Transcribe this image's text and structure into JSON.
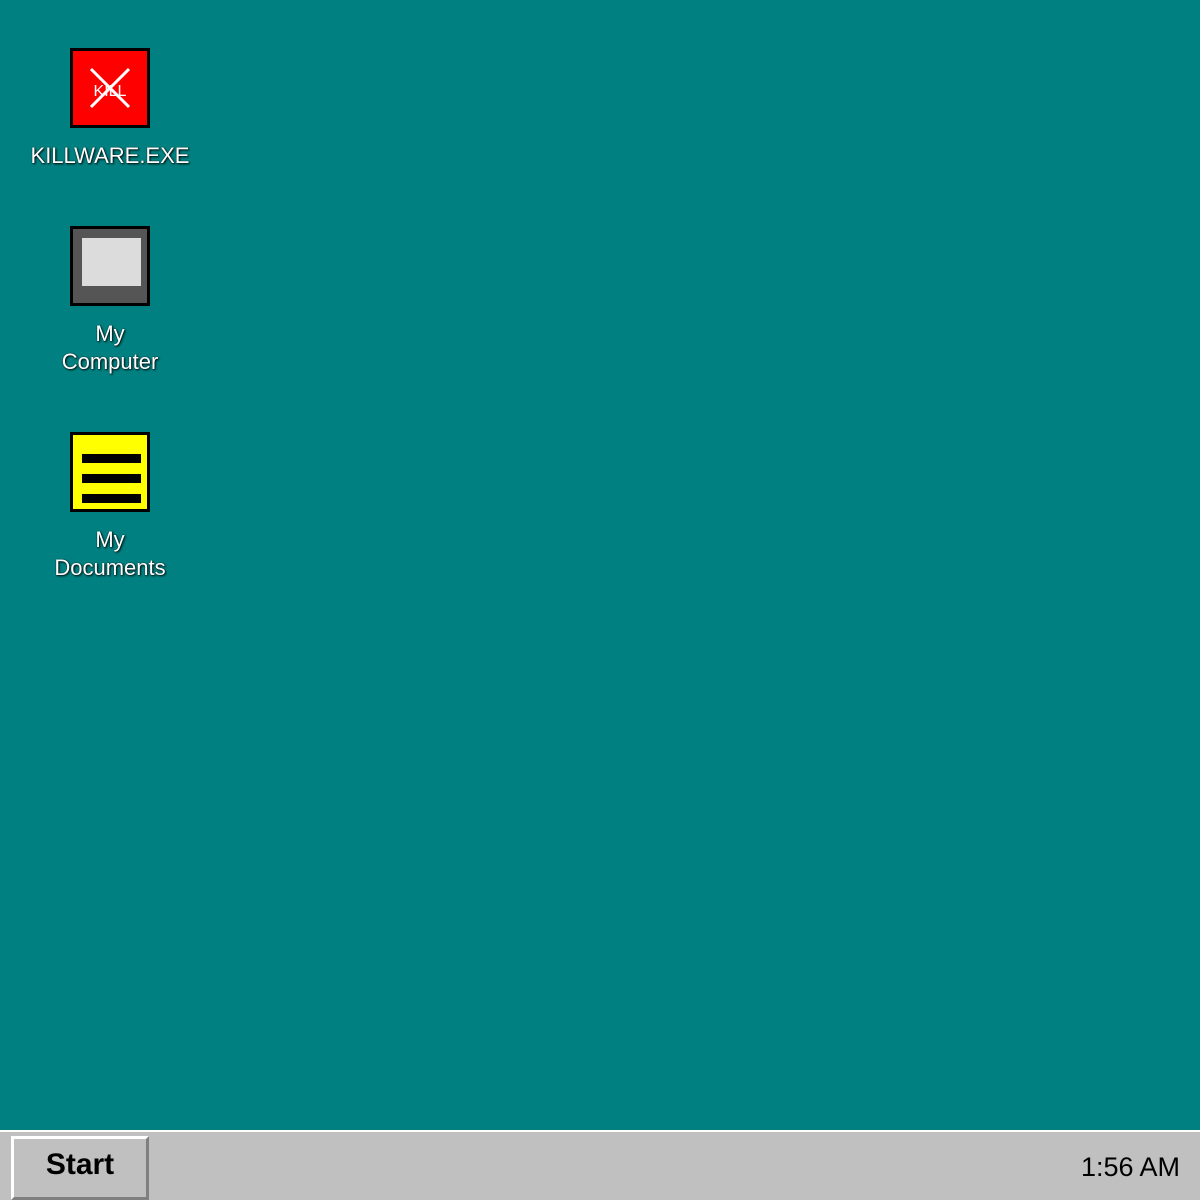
{
  "desktop": {
    "background_color": "#008080",
    "icons": [
      {
        "label": "KILLWARE.EXE",
        "icon": "killware-icon",
        "icon_text": "KILL",
        "color": "#ff0000"
      },
      {
        "label": "My\nComputer",
        "icon": "computer-icon",
        "color": "#555555"
      },
      {
        "label": "My\nDocuments",
        "icon": "documents-icon",
        "color": "#ffff00"
      }
    ]
  },
  "taskbar": {
    "start_label": "Start",
    "clock": "1:56 AM",
    "color": "#c0c0c0"
  }
}
